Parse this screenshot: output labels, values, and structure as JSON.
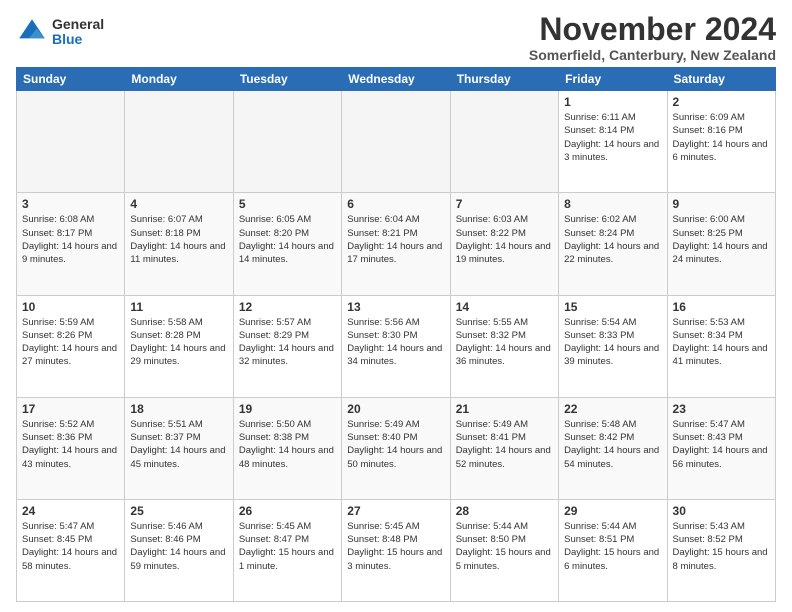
{
  "header": {
    "logo_general": "General",
    "logo_blue": "Blue",
    "month_title": "November 2024",
    "subtitle": "Somerfield, Canterbury, New Zealand"
  },
  "days_of_week": [
    "Sunday",
    "Monday",
    "Tuesday",
    "Wednesday",
    "Thursday",
    "Friday",
    "Saturday"
  ],
  "weeks": [
    [
      {
        "day": "",
        "empty": true
      },
      {
        "day": "",
        "empty": true
      },
      {
        "day": "",
        "empty": true
      },
      {
        "day": "",
        "empty": true
      },
      {
        "day": "",
        "empty": true
      },
      {
        "day": "1",
        "sunrise": "6:11 AM",
        "sunset": "8:14 PM",
        "daylight": "14 hours and 3 minutes."
      },
      {
        "day": "2",
        "sunrise": "6:09 AM",
        "sunset": "8:16 PM",
        "daylight": "14 hours and 6 minutes."
      }
    ],
    [
      {
        "day": "3",
        "sunrise": "6:08 AM",
        "sunset": "8:17 PM",
        "daylight": "14 hours and 9 minutes."
      },
      {
        "day": "4",
        "sunrise": "6:07 AM",
        "sunset": "8:18 PM",
        "daylight": "14 hours and 11 minutes."
      },
      {
        "day": "5",
        "sunrise": "6:05 AM",
        "sunset": "8:20 PM",
        "daylight": "14 hours and 14 minutes."
      },
      {
        "day": "6",
        "sunrise": "6:04 AM",
        "sunset": "8:21 PM",
        "daylight": "14 hours and 17 minutes."
      },
      {
        "day": "7",
        "sunrise": "6:03 AM",
        "sunset": "8:22 PM",
        "daylight": "14 hours and 19 minutes."
      },
      {
        "day": "8",
        "sunrise": "6:02 AM",
        "sunset": "8:24 PM",
        "daylight": "14 hours and 22 minutes."
      },
      {
        "day": "9",
        "sunrise": "6:00 AM",
        "sunset": "8:25 PM",
        "daylight": "14 hours and 24 minutes."
      }
    ],
    [
      {
        "day": "10",
        "sunrise": "5:59 AM",
        "sunset": "8:26 PM",
        "daylight": "14 hours and 27 minutes."
      },
      {
        "day": "11",
        "sunrise": "5:58 AM",
        "sunset": "8:28 PM",
        "daylight": "14 hours and 29 minutes."
      },
      {
        "day": "12",
        "sunrise": "5:57 AM",
        "sunset": "8:29 PM",
        "daylight": "14 hours and 32 minutes."
      },
      {
        "day": "13",
        "sunrise": "5:56 AM",
        "sunset": "8:30 PM",
        "daylight": "14 hours and 34 minutes."
      },
      {
        "day": "14",
        "sunrise": "5:55 AM",
        "sunset": "8:32 PM",
        "daylight": "14 hours and 36 minutes."
      },
      {
        "day": "15",
        "sunrise": "5:54 AM",
        "sunset": "8:33 PM",
        "daylight": "14 hours and 39 minutes."
      },
      {
        "day": "16",
        "sunrise": "5:53 AM",
        "sunset": "8:34 PM",
        "daylight": "14 hours and 41 minutes."
      }
    ],
    [
      {
        "day": "17",
        "sunrise": "5:52 AM",
        "sunset": "8:36 PM",
        "daylight": "14 hours and 43 minutes."
      },
      {
        "day": "18",
        "sunrise": "5:51 AM",
        "sunset": "8:37 PM",
        "daylight": "14 hours and 45 minutes."
      },
      {
        "day": "19",
        "sunrise": "5:50 AM",
        "sunset": "8:38 PM",
        "daylight": "14 hours and 48 minutes."
      },
      {
        "day": "20",
        "sunrise": "5:49 AM",
        "sunset": "8:40 PM",
        "daylight": "14 hours and 50 minutes."
      },
      {
        "day": "21",
        "sunrise": "5:49 AM",
        "sunset": "8:41 PM",
        "daylight": "14 hours and 52 minutes."
      },
      {
        "day": "22",
        "sunrise": "5:48 AM",
        "sunset": "8:42 PM",
        "daylight": "14 hours and 54 minutes."
      },
      {
        "day": "23",
        "sunrise": "5:47 AM",
        "sunset": "8:43 PM",
        "daylight": "14 hours and 56 minutes."
      }
    ],
    [
      {
        "day": "24",
        "sunrise": "5:47 AM",
        "sunset": "8:45 PM",
        "daylight": "14 hours and 58 minutes."
      },
      {
        "day": "25",
        "sunrise": "5:46 AM",
        "sunset": "8:46 PM",
        "daylight": "14 hours and 59 minutes."
      },
      {
        "day": "26",
        "sunrise": "5:45 AM",
        "sunset": "8:47 PM",
        "daylight": "15 hours and 1 minute."
      },
      {
        "day": "27",
        "sunrise": "5:45 AM",
        "sunset": "8:48 PM",
        "daylight": "15 hours and 3 minutes."
      },
      {
        "day": "28",
        "sunrise": "5:44 AM",
        "sunset": "8:50 PM",
        "daylight": "15 hours and 5 minutes."
      },
      {
        "day": "29",
        "sunrise": "5:44 AM",
        "sunset": "8:51 PM",
        "daylight": "15 hours and 6 minutes."
      },
      {
        "day": "30",
        "sunrise": "5:43 AM",
        "sunset": "8:52 PM",
        "daylight": "15 hours and 8 minutes."
      }
    ]
  ]
}
